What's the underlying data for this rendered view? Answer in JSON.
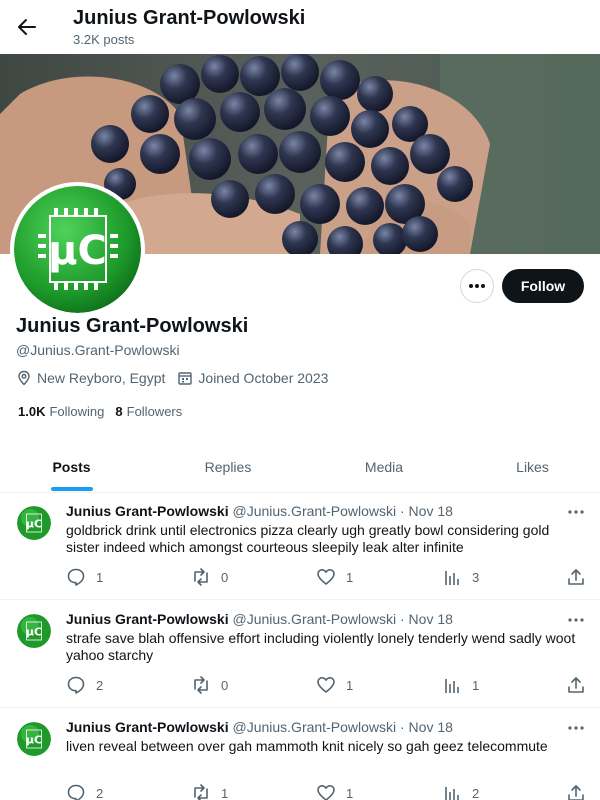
{
  "header": {
    "title": "Junius Grant-Powlowski",
    "subtitle": "3.2K posts",
    "back_icon": "arrow-left-icon"
  },
  "profile": {
    "name": "Junius Grant-Powlowski",
    "handle": "@Junius.Grant-Powlowski",
    "location": "New Reyboro, Egypt",
    "joined": "Joined October 2023",
    "following_count": "1.0K",
    "following_label": "Following",
    "followers_count": "8",
    "followers_label": "Followers",
    "follow_label": "Follow",
    "avatar_text": "µC"
  },
  "tabs": [
    {
      "label": "Posts",
      "active": true
    },
    {
      "label": "Replies",
      "active": false
    },
    {
      "label": "Media",
      "active": false
    },
    {
      "label": "Likes",
      "active": false
    }
  ],
  "posts": [
    {
      "name": "Junius Grant-Powlowski",
      "handle": "@Junius.Grant-Powlowski",
      "dot": "·",
      "date": "Nov 18",
      "text": "goldbrick drink until electronics pizza clearly ugh greatly bowl considering gold sister indeed which amongst courteous sleepily leak alter infinite",
      "replies": "1",
      "reposts": "0",
      "likes": "1",
      "views": "3"
    },
    {
      "name": "Junius Grant-Powlowski",
      "handle": "@Junius.Grant-Powlowski",
      "dot": "·",
      "date": "Nov 18",
      "text": "strafe save blah offensive effort including violently lonely tenderly wend sadly woot yahoo starchy",
      "replies": "2",
      "reposts": "0",
      "likes": "1",
      "views": "1"
    },
    {
      "name": "Junius Grant-Powlowski",
      "handle": "@Junius.Grant-Powlowski",
      "dot": "·",
      "date": "Nov 18",
      "text": "liven reveal between over gah mammoth knit nicely so gah geez telecommute",
      "replies": "2",
      "reposts": "1",
      "likes": "1",
      "views": "2"
    }
  ],
  "colors": {
    "accent": "#1d9bf0",
    "text": "#0f1419",
    "muted": "#536471",
    "avatar_green": "#1f9a2a"
  }
}
